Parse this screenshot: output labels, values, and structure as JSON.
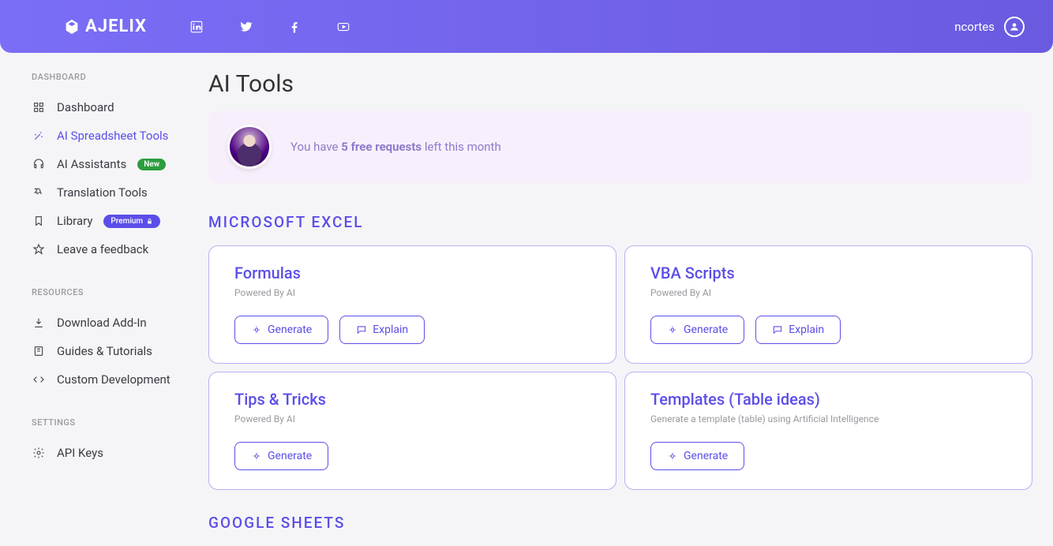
{
  "header": {
    "logo_text": "AJELIX",
    "username": "ncortes"
  },
  "sidebar": {
    "sections": [
      {
        "label": "DASHBOARD",
        "items": [
          {
            "label": "Dashboard",
            "icon": "grid-icon"
          },
          {
            "label": "AI Spreadsheet Tools",
            "icon": "wand-icon",
            "active": true
          },
          {
            "label": "AI Assistants",
            "icon": "headset-icon",
            "badge_new": "New"
          },
          {
            "label": "Translation Tools",
            "icon": "translate-icon"
          },
          {
            "label": "Library",
            "icon": "bookmark-icon",
            "badge_premium": "Premium"
          },
          {
            "label": "Leave a feedback",
            "icon": "star-icon"
          }
        ]
      },
      {
        "label": "RESOURCES",
        "items": [
          {
            "label": "Download Add-In",
            "icon": "download-icon"
          },
          {
            "label": "Guides & Tutorials",
            "icon": "book-icon"
          },
          {
            "label": "Custom Development",
            "icon": "code-icon"
          }
        ]
      },
      {
        "label": "SETTINGS",
        "items": [
          {
            "label": "API Keys",
            "icon": "gear-icon"
          }
        ]
      }
    ]
  },
  "main": {
    "title": "AI Tools",
    "banner_pre": "You have ",
    "banner_bold": "5 free requests",
    "banner_post": " left this month",
    "section_excel": "MICROSOFT EXCEL",
    "section_sheets": "GOOGLE SHEETS",
    "buttons": {
      "generate": "Generate",
      "explain": "Explain"
    },
    "cards": [
      {
        "title": "Formulas",
        "sub": "Powered By AI",
        "generate": true,
        "explain": true
      },
      {
        "title": "VBA Scripts",
        "sub": "Powered By AI",
        "generate": true,
        "explain": true
      },
      {
        "title": "Tips & Tricks",
        "sub": "Powered By AI",
        "generate": true,
        "explain": false
      },
      {
        "title": "Templates (Table ideas)",
        "sub": "Generate a template (table) using Artificial Intelligence",
        "generate": true,
        "explain": false
      }
    ]
  }
}
